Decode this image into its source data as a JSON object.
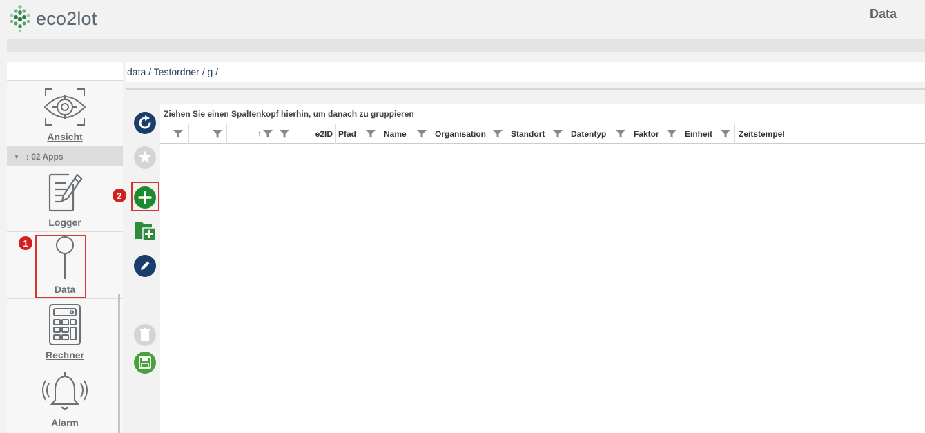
{
  "app": {
    "name": "eco2lot",
    "page_title": "Data"
  },
  "breadcrumb": "data / Testordner / g /",
  "sidebar": {
    "items": [
      {
        "label": "Ansicht",
        "icon": "eye-scan-icon"
      },
      {
        "group": ": 02 Apps"
      },
      {
        "label": "Logger",
        "icon": "notepad-pencil-icon"
      },
      {
        "label": "Data",
        "icon": "pin-icon"
      },
      {
        "label": "Rechner",
        "icon": "calculator-icon"
      },
      {
        "label": "Alarm",
        "icon": "bell-icon"
      }
    ]
  },
  "toolbar": {
    "buttons": [
      "refresh-icon",
      "star-icon",
      "add-icon",
      "add-folder-icon",
      "edit-icon",
      "delete-icon",
      "save-icon"
    ]
  },
  "grid": {
    "group_hint": "Ziehen Sie einen Spaltenkopf hierhin, um danach zu gruppieren",
    "columns": [
      "",
      "",
      "",
      "e2ID",
      "Pfad",
      "Name",
      "Organisation",
      "Standort",
      "Datentyp",
      "Faktor",
      "Einheit",
      "Zeitstempel"
    ]
  },
  "markers": [
    "1",
    "2"
  ],
  "colors": {
    "accent_blue": "#1b3d6e",
    "add_green": "#1e8a2e",
    "save_green": "#46a23a",
    "marker_red": "#d21f1f"
  }
}
